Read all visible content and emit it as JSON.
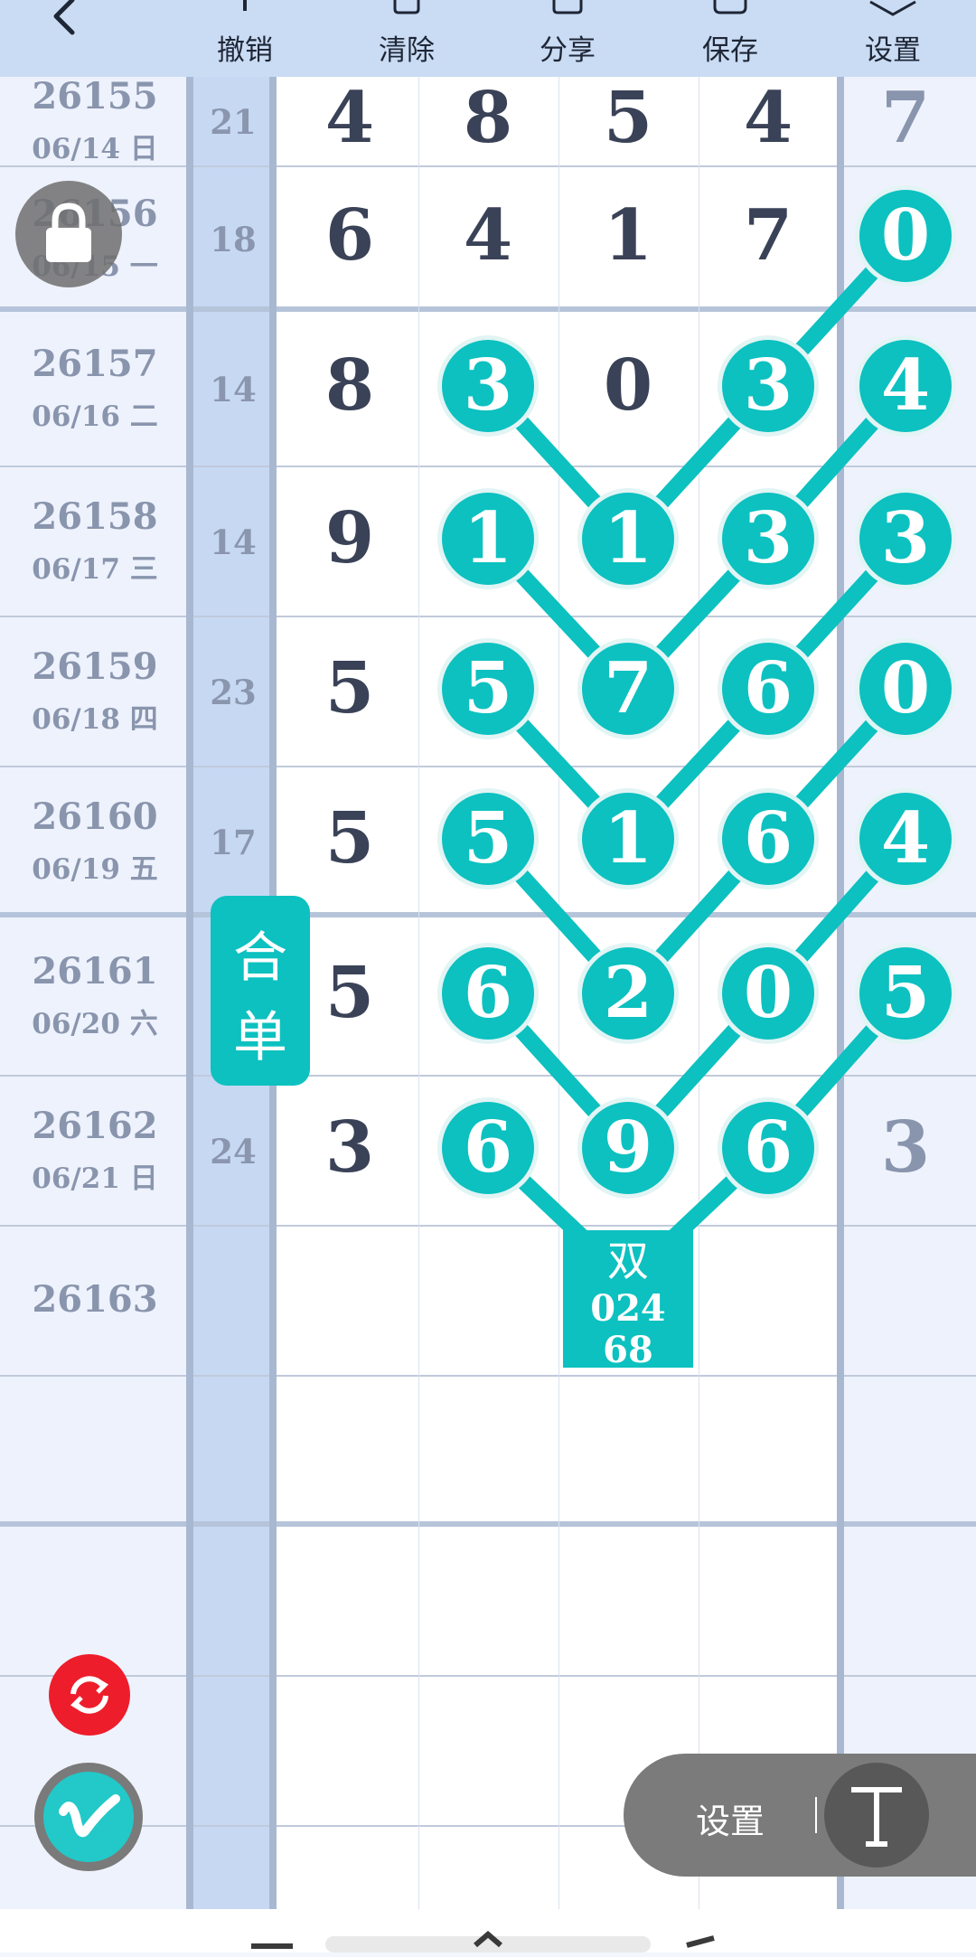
{
  "colors": {
    "accent": "#0cc1c0",
    "refresh": "#ee1d2b",
    "digit": "#3a4257",
    "muted": "#8995ad"
  },
  "toolbar": {
    "back_icon": "chevron-left-icon",
    "buttons": [
      {
        "id": "undo",
        "label": "撤销",
        "icon": "undo-icon"
      },
      {
        "id": "clear",
        "label": "清除",
        "icon": "trash-icon"
      },
      {
        "id": "share",
        "label": "分享",
        "icon": "share-icon"
      },
      {
        "id": "save",
        "label": "保存",
        "icon": "save-icon"
      },
      {
        "id": "settings",
        "label": "设置",
        "icon": "settings-icon"
      }
    ]
  },
  "rows": [
    {
      "issue": "26155",
      "date": "06/14 日",
      "sum": "21",
      "digits": [
        "4",
        "8",
        "5",
        "4",
        "7"
      ]
    },
    {
      "issue": "26156",
      "date": "06/15 一",
      "sum": "18",
      "digits": [
        "6",
        "4",
        "1",
        "7",
        "0"
      ]
    },
    {
      "issue": "26157",
      "date": "06/16 二",
      "sum": "14",
      "digits": [
        "8",
        "3",
        "0",
        "3",
        "4"
      ]
    },
    {
      "issue": "26158",
      "date": "06/17 三",
      "sum": "14",
      "digits": [
        "9",
        "1",
        "1",
        "3",
        "3"
      ]
    },
    {
      "issue": "26159",
      "date": "06/18 四",
      "sum": "23",
      "digits": [
        "5",
        "5",
        "7",
        "6",
        "0"
      ]
    },
    {
      "issue": "26160",
      "date": "06/19 五",
      "sum": "17",
      "digits": [
        "5",
        "5",
        "1",
        "6",
        "4"
      ]
    },
    {
      "issue": "26161",
      "date": "06/20 六",
      "sum": "",
      "digits": [
        "5",
        "6",
        "2",
        "0",
        "5"
      ]
    },
    {
      "issue": "26162",
      "date": "06/21 日",
      "sum": "24",
      "digits": [
        "3",
        "6",
        "9",
        "6",
        "3"
      ]
    },
    {
      "issue": "26163",
      "date": "",
      "sum": "",
      "digits": [
        "",
        "",
        "",
        "",
        ""
      ]
    },
    {
      "issue": "",
      "date": "",
      "sum": "",
      "digits": [
        "",
        "",
        "",
        "",
        ""
      ]
    },
    {
      "issue": "",
      "date": "",
      "sum": "",
      "digits": [
        "",
        "",
        "",
        "",
        ""
      ]
    },
    {
      "issue": "",
      "date": "",
      "sum": "",
      "digits": [
        "",
        "",
        "",
        "",
        ""
      ]
    },
    {
      "issue": "",
      "date": "",
      "sum": "",
      "digits": [
        "",
        "",
        "",
        "",
        ""
      ]
    }
  ],
  "marks": [
    {
      "row": 1,
      "col": 4
    },
    {
      "row": 2,
      "col": 1
    },
    {
      "row": 2,
      "col": 3
    },
    {
      "row": 2,
      "col": 4
    },
    {
      "row": 3,
      "col": 1
    },
    {
      "row": 3,
      "col": 2
    },
    {
      "row": 3,
      "col": 3
    },
    {
      "row": 3,
      "col": 4
    },
    {
      "row": 4,
      "col": 1
    },
    {
      "row": 4,
      "col": 2
    },
    {
      "row": 4,
      "col": 3
    },
    {
      "row": 4,
      "col": 4
    },
    {
      "row": 5,
      "col": 1
    },
    {
      "row": 5,
      "col": 2
    },
    {
      "row": 5,
      "col": 3
    },
    {
      "row": 5,
      "col": 4
    },
    {
      "row": 6,
      "col": 1
    },
    {
      "row": 6,
      "col": 2
    },
    {
      "row": 6,
      "col": 3
    },
    {
      "row": 6,
      "col": 4
    },
    {
      "row": 7,
      "col": 1
    },
    {
      "row": 7,
      "col": 2
    },
    {
      "row": 7,
      "col": 3
    }
  ],
  "links": [
    [
      {
        "row": 1,
        "col": 4
      },
      {
        "row": 2,
        "col": 3
      }
    ],
    [
      {
        "row": 2,
        "col": 3
      },
      {
        "row": 3,
        "col": 2
      }
    ],
    [
      {
        "row": 2,
        "col": 1
      },
      {
        "row": 3,
        "col": 2
      }
    ],
    [
      {
        "row": 2,
        "col": 4
      },
      {
        "row": 3,
        "col": 3
      }
    ],
    [
      {
        "row": 3,
        "col": 3
      },
      {
        "row": 4,
        "col": 2
      }
    ],
    [
      {
        "row": 3,
        "col": 1
      },
      {
        "row": 4,
        "col": 2
      }
    ],
    [
      {
        "row": 3,
        "col": 4
      },
      {
        "row": 4,
        "col": 3
      }
    ],
    [
      {
        "row": 4,
        "col": 3
      },
      {
        "row": 5,
        "col": 2
      }
    ],
    [
      {
        "row": 4,
        "col": 1
      },
      {
        "row": 5,
        "col": 2
      }
    ],
    [
      {
        "row": 4,
        "col": 4
      },
      {
        "row": 5,
        "col": 3
      }
    ],
    [
      {
        "row": 5,
        "col": 3
      },
      {
        "row": 6,
        "col": 2
      }
    ],
    [
      {
        "row": 5,
        "col": 1
      },
      {
        "row": 6,
        "col": 2
      }
    ],
    [
      {
        "row": 5,
        "col": 4
      },
      {
        "row": 6,
        "col": 3
      }
    ],
    [
      {
        "row": 6,
        "col": 3
      },
      {
        "row": 7,
        "col": 2
      }
    ],
    [
      {
        "row": 6,
        "col": 1
      },
      {
        "row": 7,
        "col": 2
      }
    ],
    [
      {
        "row": 6,
        "col": 4
      },
      {
        "row": 7,
        "col": 3
      }
    ],
    [
      {
        "row": 7,
        "col": 1
      },
      {
        "row": 8,
        "col": 2
      }
    ],
    [
      {
        "row": 7,
        "col": 3
      },
      {
        "row": 8,
        "col": 2
      }
    ]
  ],
  "prediction": {
    "row": 8,
    "col": 2,
    "title": "双",
    "lines": [
      "024",
      "68"
    ]
  },
  "he_badge": {
    "chars": [
      "合",
      "单"
    ]
  },
  "floating": {
    "lock_icon": "lock-icon",
    "refresh_icon": "refresh-icon",
    "v_icon": "v-logo-icon",
    "settings_label": "设置",
    "text_icon": "text-tool-icon"
  }
}
